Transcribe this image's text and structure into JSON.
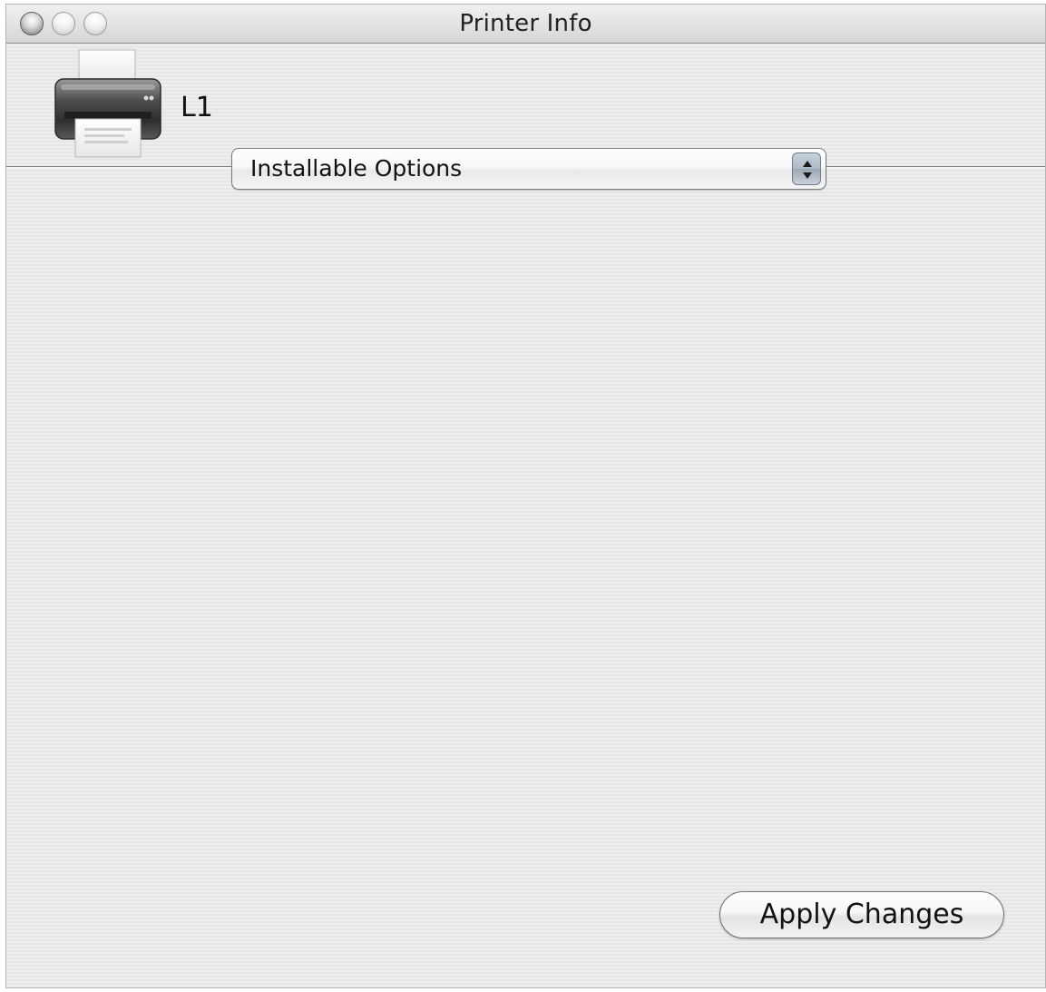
{
  "window": {
    "title": "Printer Info"
  },
  "printer": {
    "name": "L1",
    "icon": "printer-icon"
  },
  "panel_selector": {
    "selected": "Installable Options",
    "icon": "up-down-arrows-icon"
  },
  "buttons": {
    "apply_label": "Apply Changes"
  }
}
